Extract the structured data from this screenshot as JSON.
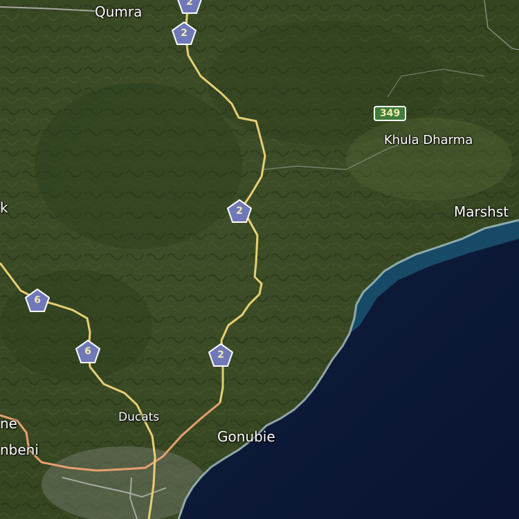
{
  "map": {
    "colors": {
      "land": "#3a4a26",
      "forest": "#2b3d1c",
      "ocean_deep": "#0c1a38",
      "ocean_shallow": "#1f6a86",
      "surf": "#a9c4c7",
      "road_primary": "#e8cf73",
      "road_arterial": "#e8a070",
      "road_minor": "#b8b8b8",
      "shield_fill": "#6f78b8",
      "shield_text": "#f4e9b0",
      "route_box": "#3f7d3a"
    },
    "places": [
      {
        "id": "qumra",
        "label": "Qumra"
      },
      {
        "id": "khula-dharma",
        "label": "Khula Dharma"
      },
      {
        "id": "marshst",
        "label": "Marshst"
      },
      {
        "id": "k",
        "label": "k"
      },
      {
        "id": "ducats",
        "label": "Ducats"
      },
      {
        "id": "gonubie",
        "label": "Gonubie"
      },
      {
        "id": "ne",
        "label": "ne"
      },
      {
        "id": "nbeni",
        "label": "nbeni"
      }
    ],
    "shields": [
      {
        "id": "a",
        "label": "2"
      },
      {
        "id": "b",
        "label": "2"
      },
      {
        "id": "c",
        "label": "2"
      },
      {
        "id": "d",
        "label": "2"
      },
      {
        "id": "e",
        "label": "6"
      },
      {
        "id": "f",
        "label": "6"
      }
    ],
    "route_boxes": [
      {
        "id": "r349",
        "label": "349"
      }
    ]
  }
}
